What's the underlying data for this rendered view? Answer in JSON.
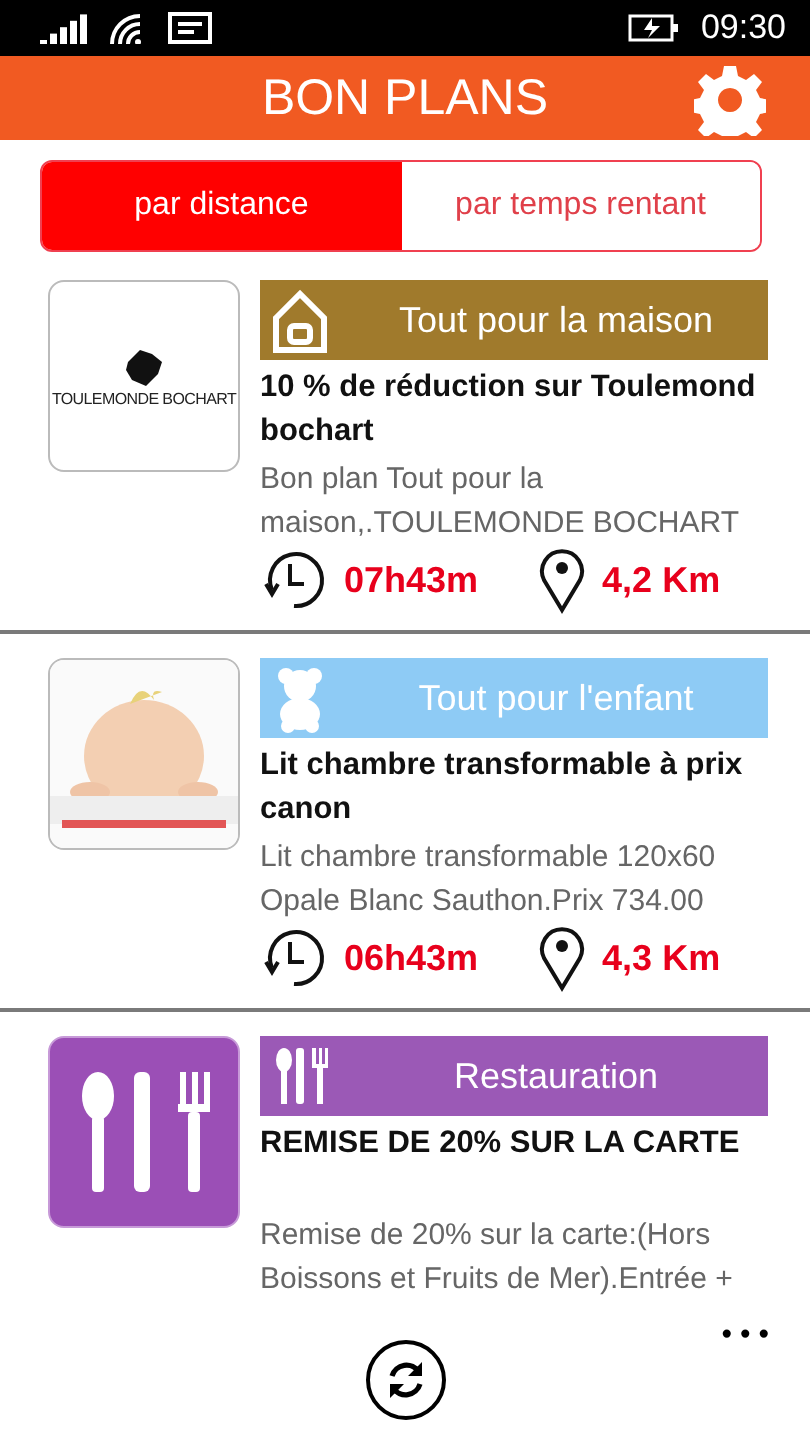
{
  "status_bar": {
    "time": "09:30"
  },
  "header": {
    "title": "BON PLANS"
  },
  "tabs": [
    {
      "label": "par distance",
      "selected": true
    },
    {
      "label": "par temps rentant",
      "selected": false
    }
  ],
  "deals": [
    {
      "thumbnail": {
        "kind": "logo",
        "text": "TOULEMONDE BOCHART"
      },
      "category": {
        "label": "Tout pour la maison",
        "color": "#a07a2c",
        "kind": "house"
      },
      "title": "10 % de réduction sur Toulemond bochart",
      "description": "Bon plan Tout pour la maison,.TOULEMONDE BOCHART",
      "time": "07h43m",
      "distance": "4,2 Km"
    },
    {
      "category": {
        "label": "Tout pour l'enfant",
        "color": "#8ecbf5",
        "kind": "bear"
      },
      "title": "Lit chambre transformable à prix canon",
      "description": "Lit chambre transformable 120x60 Opale Blanc Sauthon.Prix 734.00",
      "time": "06h43m",
      "distance": "4,3 Km"
    },
    {
      "thumbnail": {
        "kind": "cutlery"
      },
      "category": {
        "label": "Restauration",
        "color": "#9b59b6",
        "kind": "cutlery"
      },
      "title": "REMISE DE 20% SUR LA CARTE",
      "description": "Remise de 20% sur la carte:(Hors Boissons et Fruits de Mer).Entrée +"
    }
  ],
  "app_bar": {
    "more": "•••"
  }
}
